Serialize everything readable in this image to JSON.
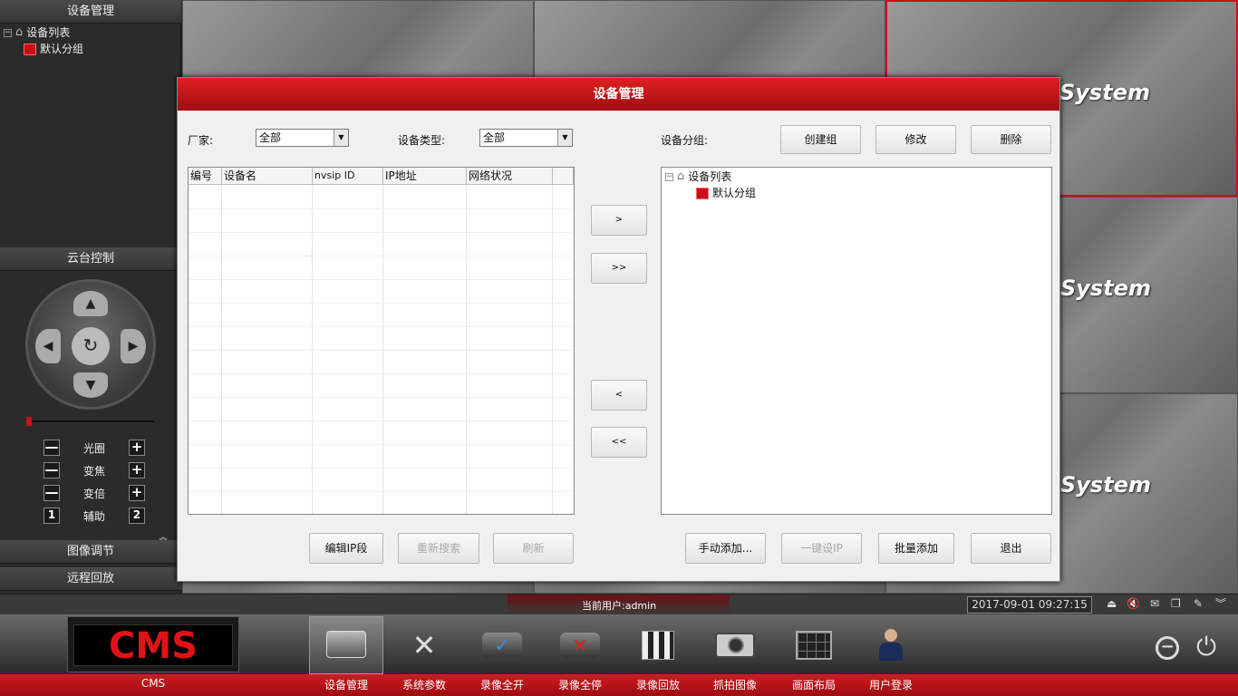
{
  "left_panel": {
    "device_mgmt_header": "设备管理",
    "tree_root": "设备列表",
    "tree_child": "默认分组",
    "ptz_header": "云台控制",
    "controls": [
      {
        "minus": "—",
        "label": "光圈",
        "plus": "+"
      },
      {
        "minus": "—",
        "label": "变焦",
        "plus": "+"
      },
      {
        "minus": "—",
        "label": "变倍",
        "plus": "+"
      },
      {
        "minus": "1",
        "label": "辅助",
        "plus": "2"
      }
    ],
    "image_adjust": "图像调节",
    "remote_playback": "远程回放"
  },
  "video_grid": {
    "watermark": "System"
  },
  "dialog": {
    "title": "设备管理",
    "vendor_label": "厂家:",
    "vendor_value": "全部",
    "type_label": "设备类型:",
    "type_value": "全部",
    "group_label": "设备分组:",
    "create_group": "创建组",
    "modify": "修改",
    "delete": "删除",
    "columns": [
      "编号",
      "设备名",
      "nvsip ID",
      "IP地址",
      "网络状况"
    ],
    "move_right": ">",
    "move_all_right": ">>",
    "move_left": "<",
    "move_all_left": "<<",
    "tree_root": "设备列表",
    "tree_child": "默认分组",
    "edit_ip": "编辑IP段",
    "research": "重新搜索",
    "refresh": "刷新",
    "manual_add": "手动添加...",
    "one_key_ip": "一键设IP",
    "batch_add": "批量添加",
    "exit": "退出"
  },
  "status_bar": {
    "current_user": "当前用户:admin",
    "datetime": "2017-09-01 09:27:15"
  },
  "taskbar": {
    "logo": "CMS",
    "logo_label": "CMS",
    "items": [
      {
        "label": "设备管理",
        "icon": "device-manage-icon"
      },
      {
        "label": "系统参数",
        "icon": "tools-icon"
      },
      {
        "label": "录像全开",
        "icon": "record-start-icon"
      },
      {
        "label": "录像全停",
        "icon": "record-stop-icon"
      },
      {
        "label": "录像回放",
        "icon": "playback-icon"
      },
      {
        "label": "抓拍图像",
        "icon": "camera-icon"
      },
      {
        "label": "画面布局",
        "icon": "layout-icon"
      },
      {
        "label": "用户登录",
        "icon": "user-icon"
      }
    ]
  },
  "colors": {
    "accent": "#c8101a",
    "panel": "#2b2b2b",
    "dialog_bg": "#f0f0f0"
  }
}
